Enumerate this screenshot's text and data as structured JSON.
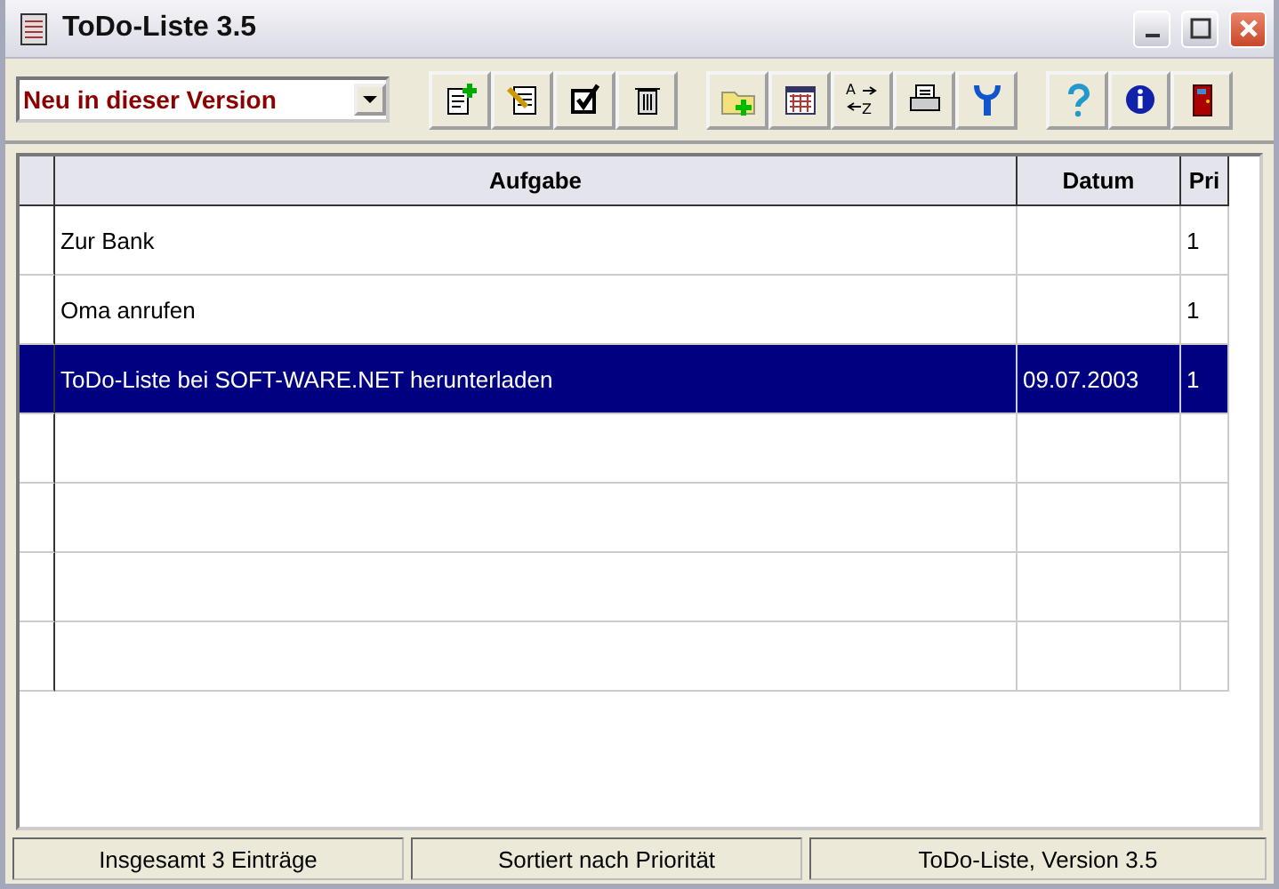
{
  "window": {
    "title": "ToDo-Liste 3.5"
  },
  "toolbar": {
    "dropdown": {
      "value": "Neu in dieser Version"
    },
    "sort_button": {
      "letters": [
        "A",
        "Z"
      ]
    }
  },
  "table": {
    "columns": [
      "Aufgabe",
      "Datum",
      "Pri"
    ],
    "rows": [
      {
        "cells": [
          "Zur Bank",
          "",
          "1"
        ],
        "selected": false
      },
      {
        "cells": [
          "Oma anrufen",
          "",
          "1"
        ],
        "selected": false
      },
      {
        "cells": [
          "ToDo-Liste bei SOFT-WARE.NET herunterladen",
          "09.07.2003",
          "1"
        ],
        "selected": true
      }
    ]
  },
  "status_bar": [
    "Insgesamt 3 Einträge",
    "Sortiert nach Priorität",
    "ToDo-Liste, Version 3.5"
  ]
}
